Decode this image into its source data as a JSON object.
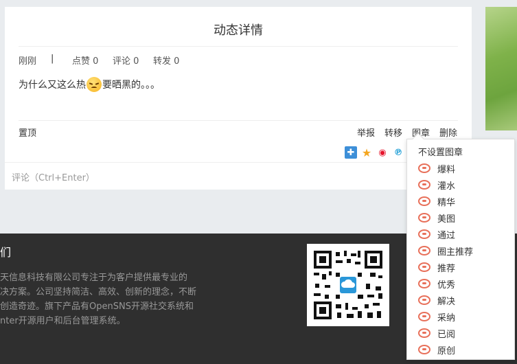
{
  "post": {
    "title": "动态详情",
    "time": "刚刚",
    "separator": "|",
    "likes": "点赞 0",
    "comments": "评论 0",
    "reposts": "转发 0",
    "content_before": "为什么又这么热",
    "content_after": "要晒黑的。。。",
    "pin": "置顶",
    "actions": {
      "report": "举报",
      "forward": "转移",
      "stamp": "图章",
      "delete": "删除"
    },
    "comment_placeholder": "评论（Ctrl+Enter）"
  },
  "share_icons": [
    "qzone-icon",
    "star-icon",
    "weibo-icon",
    "pinterest-icon"
  ],
  "footer": {
    "title": "们",
    "lines": [
      "天信息科技有限公司专注于为客户提供最专业的",
      "决方案。公司坚持简洁、高效、创新的理念，不断",
      "创造奇迹。旗下产品有OpenSNS开源社交系统和",
      "nter开源用户和后台管理系统。"
    ]
  },
  "stamp_menu": {
    "none": "不设置图章",
    "items": [
      "爆料",
      "灌水",
      "精华",
      "美图",
      "通过",
      "圈主推荐",
      "推荐",
      "优秀",
      "解决",
      "采纳",
      "已阅",
      "原创"
    ]
  },
  "colors": {
    "stamp": "#e8705a",
    "footer_bg": "#2f2f2f"
  }
}
